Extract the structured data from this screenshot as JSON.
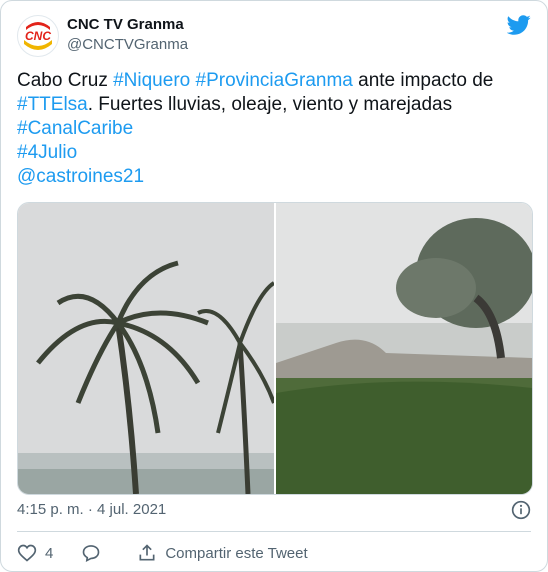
{
  "header": {
    "display_name": "CNC TV Granma",
    "handle": "@CNCTVGranma",
    "avatar_text": "CNC"
  },
  "tweet": {
    "line1_plain": "Cabo Cruz ",
    "line1_tag1": "#Niquero",
    "line1_sp": " ",
    "line1_tag2": "#ProvinciaGranma",
    "line1_tail": " ante impacto de",
    "line2_tag": "#TTElsa",
    "line2_tail": ". Fuertes lluvias, oleaje, viento y marejadas",
    "line3_tag": "#CanalCaribe",
    "line4_tag": "#4Julio",
    "line5_mention": "@castroines21"
  },
  "meta": {
    "timestamp": "4:15 p. m. · 4 jul. 2021"
  },
  "actions": {
    "like_count": "4",
    "share_label": "Compartir este Tweet"
  },
  "colors": {
    "link": "#1d9bf0",
    "secondary_text": "#536471",
    "border": "#cfd9de"
  }
}
